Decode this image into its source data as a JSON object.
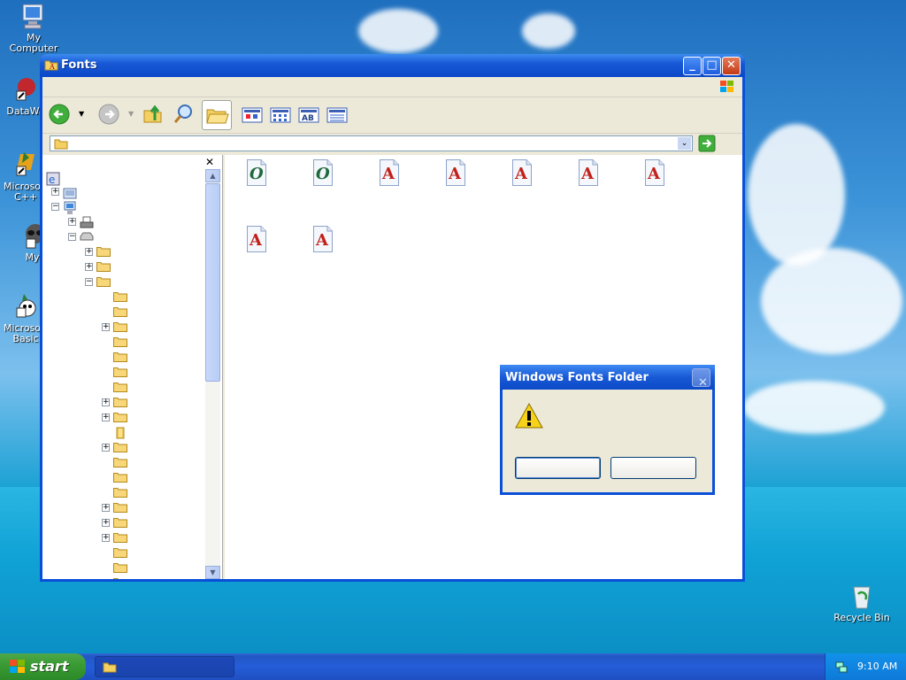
{
  "desktop": {
    "icons": [
      {
        "label": "My Computer"
      },
      {
        "label": "DataWa"
      },
      {
        "label": "Microsoft C++"
      },
      {
        "label": "Myp"
      },
      {
        "label": "Microsoft Basic"
      },
      {
        "label": "Recycle Bin"
      }
    ]
  },
  "window": {
    "title": "Fonts",
    "address_value": ""
  },
  "dialog": {
    "title": "Windows Fonts Folder",
    "message": "",
    "buttons": [
      {
        "label": ""
      },
      {
        "label": ""
      }
    ]
  },
  "taskbar": {
    "start_label": "start",
    "task_label": "",
    "clock": "9:10 AM"
  },
  "font_files": [
    {
      "glyph": "O",
      "kind": "opentype"
    },
    {
      "glyph": "O",
      "kind": "opentype"
    },
    {
      "glyph": "A",
      "kind": "truetype"
    },
    {
      "glyph": "A",
      "kind": "truetype"
    },
    {
      "glyph": "A",
      "kind": "truetype"
    },
    {
      "glyph": "A",
      "kind": "truetype"
    },
    {
      "glyph": "A",
      "kind": "truetype"
    },
    {
      "glyph": "A",
      "kind": "truetype"
    },
    {
      "glyph": "A",
      "kind": "truetype"
    }
  ],
  "colors": {
    "titlebar": "#0b47c8",
    "accent_green": "#3a9b34",
    "truetype_red": "#c0211a",
    "opentype_green": "#1e6a3a"
  }
}
